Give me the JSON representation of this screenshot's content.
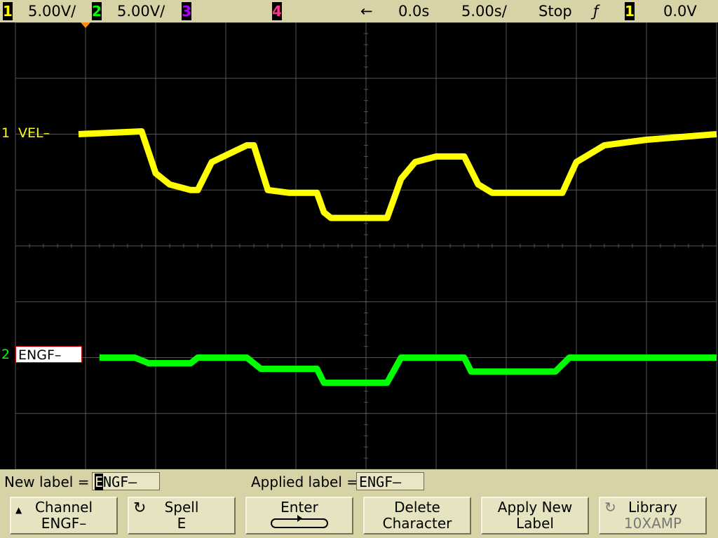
{
  "colors": {
    "ch1": "#ffff00",
    "ch2": "#00ff00",
    "ch3": "#b000ff",
    "ch4": "#ff2f8e",
    "grid": "#555555",
    "trigger_marker": "#ff8c1a",
    "bar": "#d7d3a7"
  },
  "status_bar": {
    "ch1_num": "1",
    "ch1_scale": "5.00V/",
    "ch2_num": "2",
    "ch2_scale": "5.00V/",
    "ch3_num": "3",
    "ch4_num": "4",
    "delay_arrow": "←",
    "delay": "0.0s",
    "timebase": "5.00s/",
    "run_state": "Stop",
    "trigger_slope_icon": "rising-edge-icon",
    "trigger_slope_glyph": "ƒ",
    "trigger_source": "1",
    "trigger_level": "0.0V"
  },
  "traces": {
    "ch1": {
      "marker": "1",
      "label": "VEL–"
    },
    "ch2": {
      "marker": "2",
      "label": "ENGF–"
    }
  },
  "chart_data": {
    "type": "line",
    "x_divisions": 10,
    "y_divisions": 8,
    "series": [
      {
        "name": "VEL",
        "channel": 1,
        "x": [
          0.9,
          1.8,
          2.0,
          2.2,
          2.5,
          2.6,
          2.8,
          3.3,
          3.4,
          3.6,
          3.9,
          4.3,
          4.4,
          4.5,
          5.3,
          5.5,
          5.7,
          6.0,
          6.4,
          6.6,
          6.8,
          7.0,
          7.8,
          8.0,
          8.4,
          9.0,
          10.0
        ],
        "y": [
          2.0,
          2.05,
          1.3,
          1.1,
          1.0,
          1.0,
          1.5,
          1.8,
          1.8,
          1.0,
          0.95,
          0.95,
          0.6,
          0.5,
          0.5,
          1.2,
          1.5,
          1.6,
          1.6,
          1.1,
          0.95,
          0.95,
          0.95,
          1.5,
          1.8,
          1.9,
          2.0
        ]
      },
      {
        "name": "ENGF",
        "channel": 2,
        "x": [
          1.2,
          1.7,
          1.9,
          2.5,
          2.6,
          3.3,
          3.5,
          4.3,
          4.4,
          5.3,
          5.5,
          6.4,
          6.5,
          7.7,
          7.9,
          10.0
        ],
        "y": [
          -2.0,
          -2.0,
          -2.1,
          -2.1,
          -2.0,
          -2.0,
          -2.2,
          -2.2,
          -2.45,
          -2.45,
          -2.0,
          -2.0,
          -2.25,
          -2.25,
          -2.0,
          -2.0
        ]
      }
    ]
  },
  "label_bar": {
    "new_label_caption": "New label =",
    "new_label_cursor_char": "E",
    "new_label_rest": "NGF–",
    "applied_label_caption": "Applied label =",
    "applied_label_value": "ENGF–"
  },
  "softkeys": [
    {
      "line1": "Channel",
      "line2": "ENGF–"
    },
    {
      "line1": "Spell",
      "line2": "E"
    },
    {
      "line1": "Enter"
    },
    {
      "line1": "Delete",
      "line2": "Character"
    },
    {
      "line1": "Apply New",
      "line2": "Label"
    },
    {
      "line1": "Library",
      "line2": "10XAMP"
    }
  ]
}
